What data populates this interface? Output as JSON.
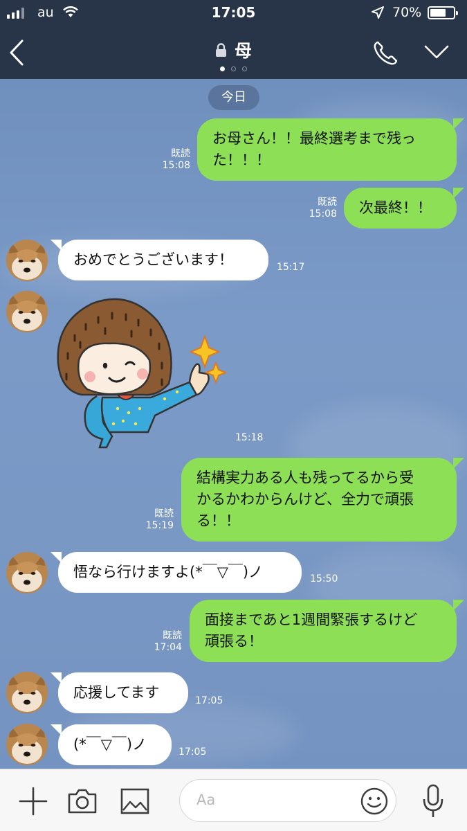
{
  "status_bar": {
    "carrier": "au",
    "time": "17:05",
    "battery_percent": "70%",
    "battery_level": 0.7,
    "signal_bars": 3
  },
  "header": {
    "title": "母",
    "page_dots": 3,
    "active_dot": 0
  },
  "date_label": "今日",
  "messages": [
    {
      "from": "me",
      "lines": [
        "お母さん！！最終選考まで残っ",
        "た！！！"
      ],
      "read": "既読",
      "time": "15:08"
    },
    {
      "from": "me",
      "lines": [
        "次最終！！"
      ],
      "read": "既読",
      "time": "15:08"
    },
    {
      "from": "them",
      "lines": [
        "おめでとうございます！"
      ],
      "time": "15:17"
    },
    {
      "from": "them",
      "type": "sticker",
      "sticker": "girl-thumbs-up-sticker",
      "time": "15:18"
    },
    {
      "from": "me",
      "lines": [
        "結構実力ある人も残ってるから受",
        "かるかわからんけど、全力で頑張",
        "る！！"
      ],
      "read": "既読",
      "time": "15:19"
    },
    {
      "from": "them",
      "lines": [
        "悟なら行けますよ(*￣▽￣)ノ"
      ],
      "time": "15:50"
    },
    {
      "from": "me",
      "lines": [
        "面接まであと1週間緊張するけど",
        "頑張る！"
      ],
      "read": "既読",
      "time": "17:04"
    },
    {
      "from": "them",
      "lines": [
        "応援してます"
      ],
      "time": "17:05"
    },
    {
      "from": "them",
      "lines": [
        "(*￣▽￣)ノ"
      ],
      "time": "17:05"
    }
  ],
  "composer": {
    "placeholder": "Aa"
  },
  "icons": {
    "back": "chevron-left-icon",
    "lock": "lock-icon",
    "call": "phone-icon",
    "more": "chevron-down-icon",
    "add": "plus-icon",
    "camera": "camera-icon",
    "image": "image-icon",
    "emoji": "emoji-icon",
    "voice": "microphone-icon"
  },
  "colors": {
    "header_bg": "#283548",
    "chat_bg": "#7a98c4",
    "my_bubble": "#8de055",
    "their_bubble": "#ffffff"
  }
}
